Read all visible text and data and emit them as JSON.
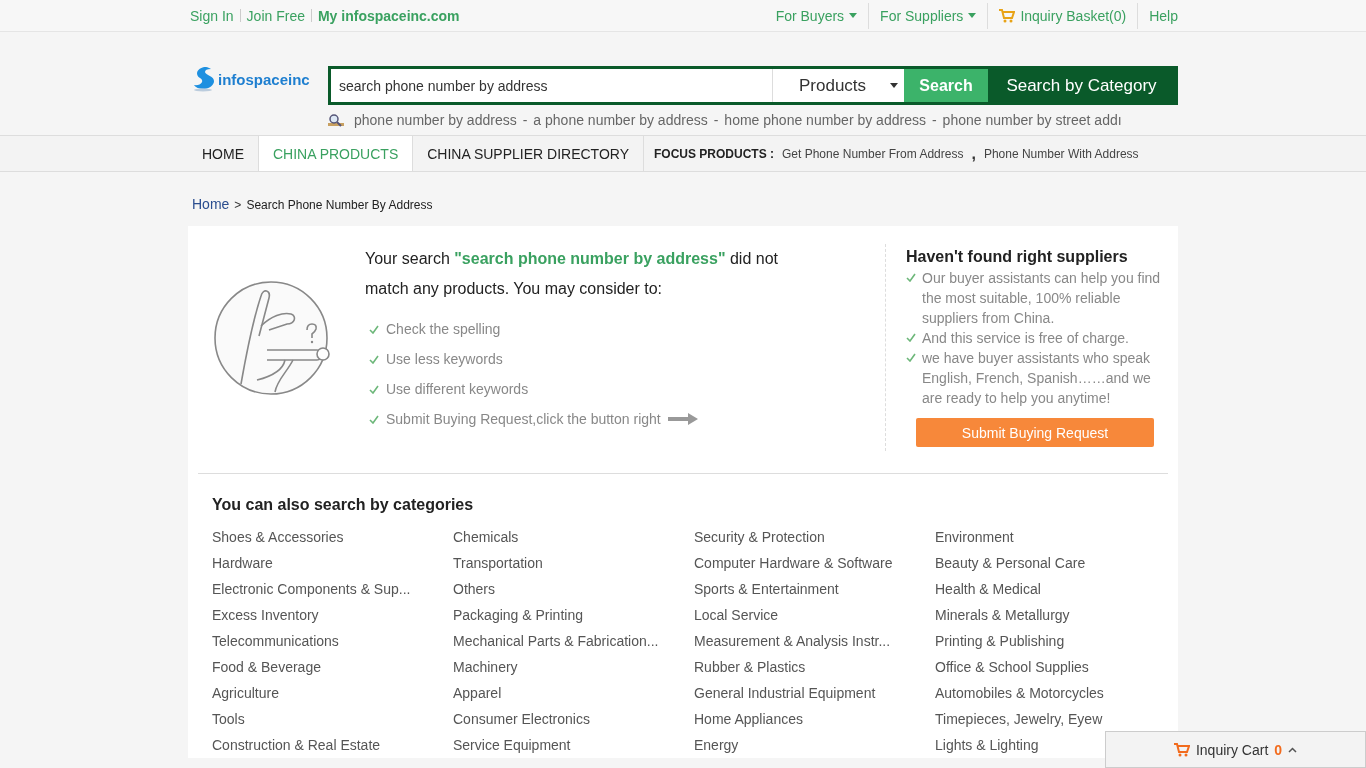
{
  "top_bar": {
    "account_links": [
      "Sign In",
      "Join Free"
    ],
    "site_link": "My infospaceinc.com",
    "menus": [
      {
        "label": "For Buyers",
        "kind": "dropdown"
      },
      {
        "label": "For Suppliers",
        "kind": "dropdown"
      },
      {
        "label": "Inquiry Basket(0)",
        "kind": "basket"
      },
      {
        "label": "Help",
        "kind": "plain"
      }
    ]
  },
  "logo": {
    "text": "infospaceinc"
  },
  "search": {
    "value": "search phone number by address",
    "scope": "Products",
    "button": "Search",
    "category_button": "Search by Category"
  },
  "suggestion_separators": [
    "-",
    "-",
    "-"
  ],
  "suggestions": [
    "phone number by address",
    "a phone number by address",
    "home phone number by address",
    "phone number by street addı"
  ],
  "nav": {
    "tabs": [
      {
        "label": "HOME",
        "selected": false
      },
      {
        "label": "CHINA PRODUCTS",
        "selected": true
      },
      {
        "label": "CHINA SUPPLIER DIRECTORY",
        "selected": false
      }
    ],
    "focus_label": "FOCUS PRODUCTS :",
    "focus_separator": ",",
    "focus_links": [
      "Get Phone Number From Address",
      "Phone Number With Address"
    ]
  },
  "breadcrumb": {
    "home": "Home",
    "separator": ">",
    "current": "Search Phone Number By Address"
  },
  "no_result": {
    "message": "Your search **\"search phone number by address\"** did not match any products. You may consider to:",
    "tips": [
      "Check the spelling",
      "Use less keywords",
      "Use different keywords",
      "Submit Buying Request,click the button right"
    ]
  },
  "assist": {
    "title": "Haven't found right suppliers",
    "points": [
      "Our buyer assistants can help you find the most suitable, 100% reliable suppliers from China.",
      "And this service is free of charge.",
      "we have buyer assistants who speak English, French, Spanish……and we are ready to help you anytime!"
    ],
    "button": "Submit Buying Request"
  },
  "categories": {
    "title": "You can also search by categories",
    "items": [
      "Shoes & Accessories",
      "Chemicals",
      "Security & Protection",
      "Environment",
      "Hardware",
      "Transportation",
      "Computer Hardware & Software",
      "Beauty & Personal Care",
      "Electronic Components & Sup...",
      "Others",
      "Sports & Entertainment",
      "Health & Medical",
      "Excess Inventory",
      "Packaging & Printing",
      "Local Service",
      "Minerals & Metallurgy",
      "Telecommunications",
      "Mechanical Parts & Fabrication...",
      "Measurement & Analysis Instr...",
      "Printing & Publishing",
      "Food & Beverage",
      "Machinery",
      "Rubber & Plastics",
      "Office & School Supplies",
      "Agriculture",
      "Apparel",
      "General Industrial Equipment",
      "Automobiles & Motorcycles",
      "Tools",
      "Consumer Electronics",
      "Home Appliances",
      "Timepieces, Jewelry, Eyew",
      "Construction & Real Estate",
      "Service Equipment",
      "Energy",
      "Lights & Lighting"
    ]
  },
  "inquiry_cart": {
    "label": "Inquiry Cart",
    "count": "0"
  }
}
